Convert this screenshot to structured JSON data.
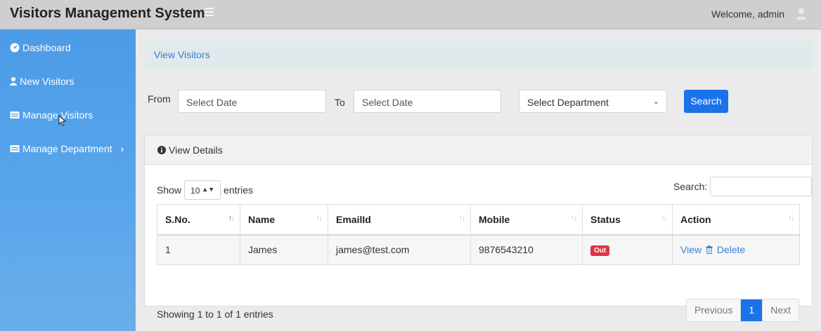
{
  "header": {
    "title": "Visitors Management System",
    "welcome": "Welcome, admin"
  },
  "sidebar": {
    "items": [
      {
        "label": "Dashboard",
        "icon": "dashboard-icon"
      },
      {
        "label": "New Visitors",
        "icon": "user-icon"
      },
      {
        "label": "Manage Visitors",
        "icon": "list-icon"
      },
      {
        "label": "Manage Department",
        "icon": "list-icon",
        "chevron": "›"
      }
    ]
  },
  "breadcrumb": {
    "label": "View Visitors"
  },
  "filters": {
    "from_label": "From",
    "from_placeholder": "Select Date",
    "to_label": "To",
    "to_placeholder": "Select Date",
    "department_selected": "Select Department",
    "search_button": "Search"
  },
  "card": {
    "title": "View Details",
    "show_label": "Show",
    "entries_value": "10",
    "entries_label": "entries",
    "search_label": "Search:",
    "columns": [
      "S.No.",
      "Name",
      "EmailId",
      "Mobile",
      "Status",
      "Action"
    ],
    "rows": [
      {
        "sno": "1",
        "name": "James",
        "email": "james@test.com",
        "mobile": "9876543210",
        "status": "Out",
        "view": "View",
        "delete": "Delete"
      }
    ],
    "info": "Showing 1 to 1 of 1 entries",
    "pagination": {
      "previous": "Previous",
      "current": "1",
      "next": "Next"
    }
  },
  "colors": {
    "accent": "#1a73e8",
    "sidebar": "#4b9be6",
    "status_out": "#dc3545",
    "link": "#3a7fd6"
  }
}
